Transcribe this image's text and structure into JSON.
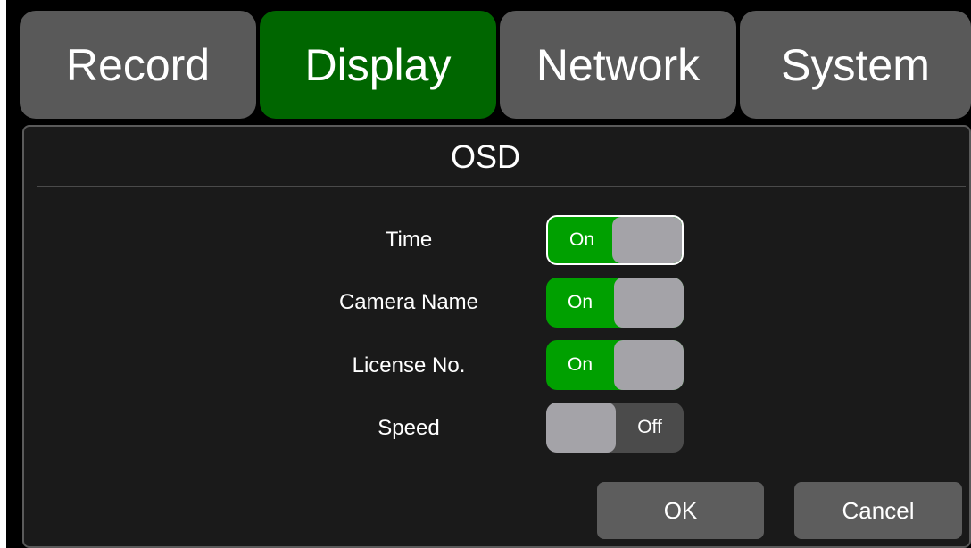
{
  "tabs": [
    {
      "label": "Record",
      "active": false
    },
    {
      "label": "Display",
      "active": true
    },
    {
      "label": "Network",
      "active": false
    },
    {
      "label": "System",
      "active": false
    }
  ],
  "panel": {
    "title": "OSD"
  },
  "settings": [
    {
      "label": "Time",
      "state": "On",
      "selected": true
    },
    {
      "label": "Camera Name",
      "state": "On",
      "selected": false
    },
    {
      "label": "License No.",
      "state": "On",
      "selected": false
    },
    {
      "label": "Speed",
      "state": "Off",
      "selected": false
    }
  ],
  "buttons": {
    "ok_label": "OK",
    "cancel_label": "Cancel"
  },
  "colors": {
    "active_tab": "#006600",
    "toggle_on": "#00a000",
    "toggle_off": "#4b4b4b",
    "knob": "#a4a3a8"
  }
}
